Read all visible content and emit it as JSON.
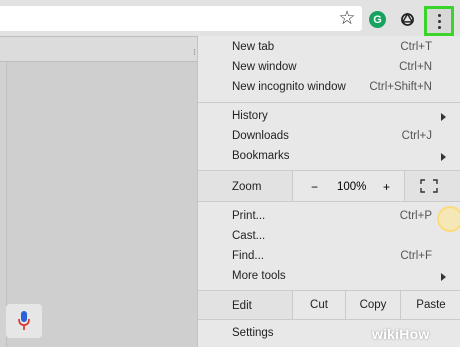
{
  "toolbar": {
    "icons": [
      "star-icon",
      "grammarly-icon",
      "openai-icon"
    ],
    "grammarly_letter": "G",
    "menu_button_highlight": "#3bd42b"
  },
  "menu": {
    "items": [
      {
        "label": "New tab",
        "shortcut": "Ctrl+T"
      },
      {
        "label": "New window",
        "shortcut": "Ctrl+N"
      },
      {
        "label": "New incognito window",
        "shortcut": "Ctrl+Shift+N"
      },
      {
        "label": "History",
        "submenu": true
      },
      {
        "label": "Downloads",
        "shortcut": "Ctrl+J"
      },
      {
        "label": "Bookmarks",
        "submenu": true
      },
      {
        "label": "Print...",
        "shortcut": "Ctrl+P"
      },
      {
        "label": "Cast..."
      },
      {
        "label": "Find...",
        "shortcut": "Ctrl+F"
      },
      {
        "label": "More tools",
        "submenu": true
      },
      {
        "label": "Settings"
      }
    ],
    "zoom": {
      "label": "Zoom",
      "minus": "−",
      "value": "100%",
      "plus": "+"
    },
    "edit": {
      "label": "Edit",
      "cut": "Cut",
      "copy": "Copy",
      "paste": "Paste"
    }
  },
  "watermark": {
    "wiki": "wiki",
    "how": "How"
  },
  "colors": {
    "menu_bg": "#e8e8e8",
    "page_bg": "#d2d2d2",
    "mic_red": "#d93025",
    "mic_blue": "#2b62d9"
  }
}
